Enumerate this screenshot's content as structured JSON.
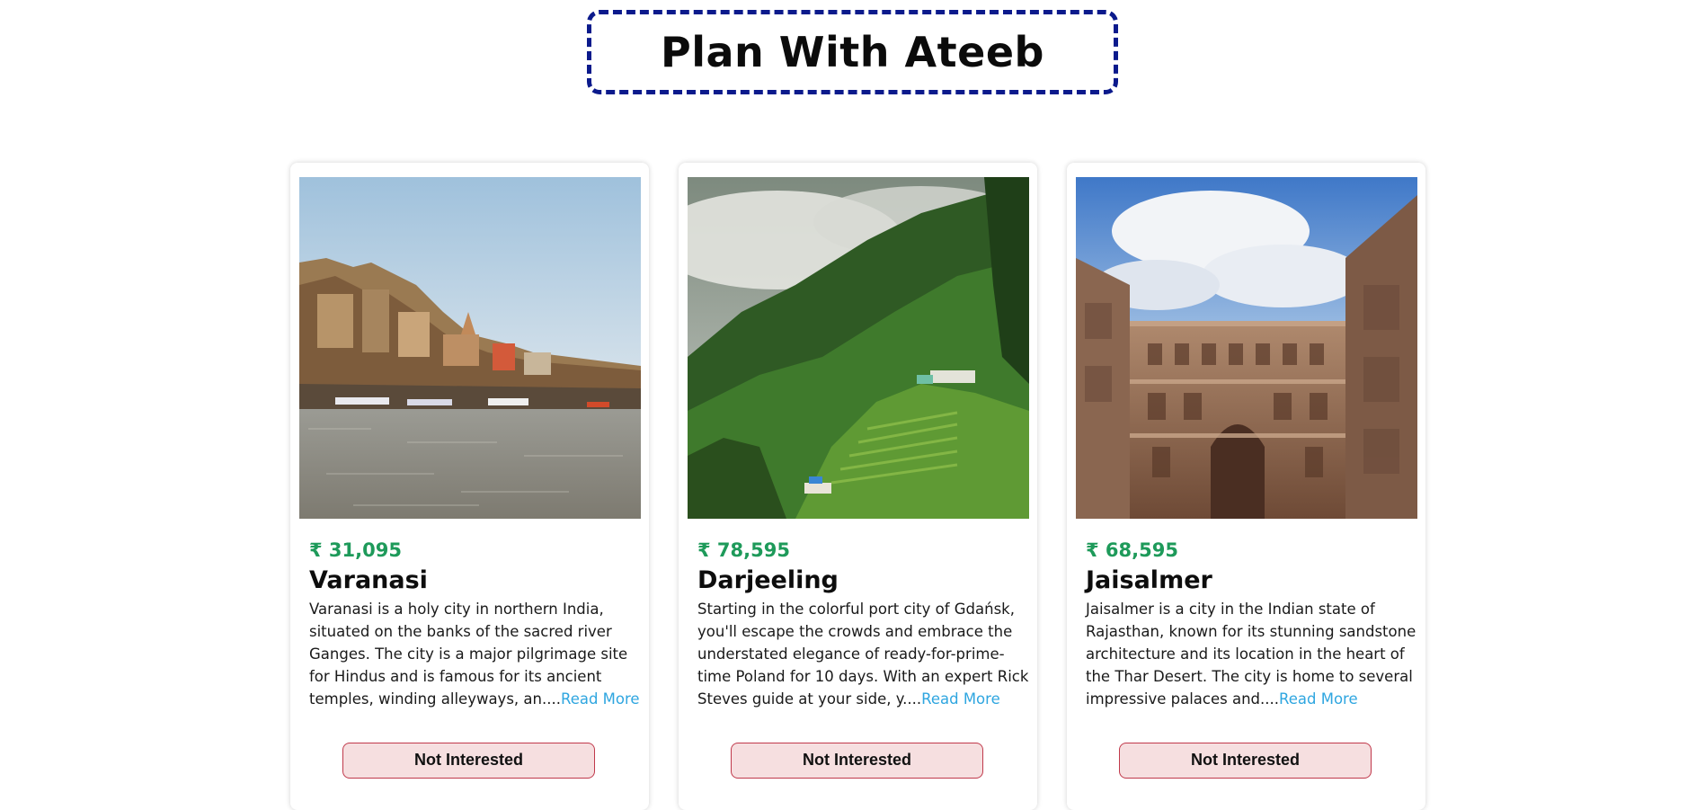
{
  "header": {
    "title": "Plan With Ateeb"
  },
  "tours": [
    {
      "price": "₹ 31,095",
      "name": "Varanasi",
      "description": "Varanasi is a holy city in northern India, situated on the banks of the sacred river Ganges. The city is a major pilgrimage site for Hindus and is famous for its ancient temples, winding alleyways, an....",
      "read_more": "Read More",
      "button": "Not Interested",
      "image": "varanasi-ghats-photo"
    },
    {
      "price": "₹ 78,595",
      "name": "Darjeeling",
      "description": "Starting in the colorful port city of Gdańsk, you'll escape the crowds and embrace the understated elegance of ready-for-prime-time Poland for 10 days. With an expert Rick Steves guide at your side, y....",
      "read_more": "Read More",
      "button": "Not Interested",
      "image": "darjeeling-hills-photo"
    },
    {
      "price": "₹ 68,595",
      "name": "Jaisalmer",
      "description": "Jaisalmer is a city in the Indian state of Rajasthan, known for its stunning sandstone architecture and its location in the heart of the Thar Desert. The city is home to several impressive palaces and....",
      "read_more": "Read More",
      "button": "Not Interested",
      "image": "jaisalmer-palace-photo"
    }
  ],
  "colors": {
    "accent_border": "#0b1a8c",
    "price": "#1e9a5a",
    "link": "#2fa6e0",
    "button_bg": "#f6dfe0",
    "button_border": "#c0394b"
  }
}
